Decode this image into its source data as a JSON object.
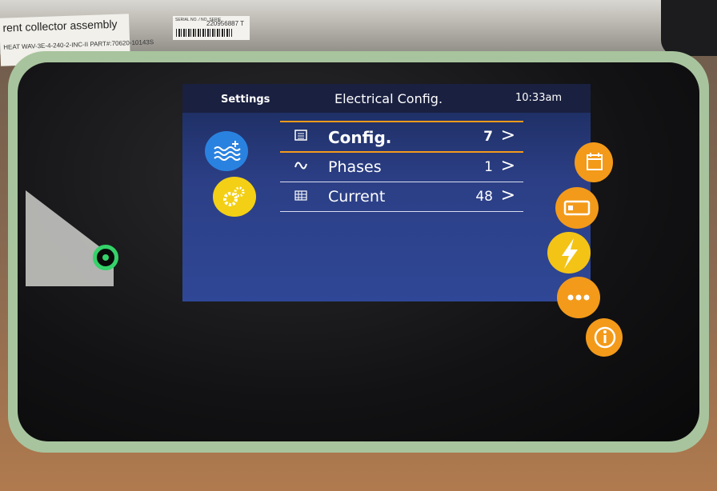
{
  "environment": {
    "sticker_title": "rent collector assembly",
    "sticker_line": "HEAT WAV-3E-4-240-2-INC-II  PART#:70620-10143S",
    "serial_label": "SERIAL NO. / NO. SERIE",
    "serial_number": "220956887 T"
  },
  "header": {
    "settings_label": "Settings",
    "title": "Electrical Config.",
    "time": "10:33am"
  },
  "menu": {
    "items": [
      {
        "label": "Config.",
        "value": "7",
        "chevron": ">"
      },
      {
        "label": "Phases",
        "value": "1",
        "chevron": ">"
      },
      {
        "label": "Current",
        "value": "48",
        "chevron": ">"
      }
    ]
  },
  "colors": {
    "accent_orange": "#f39a1a",
    "accent_yellow": "#f3d015",
    "water_blue": "#2a82e0",
    "power_green": "#35d26a"
  },
  "icons": {
    "left_nav": [
      "water-heater-icon",
      "gear-icon"
    ],
    "right_nav": [
      "calendar-icon",
      "battery-icon",
      "lightning-bolt-icon",
      "more-icon",
      "info-icon"
    ],
    "menu": [
      "config-list-icon",
      "sine-wave-icon",
      "current-meter-icon"
    ]
  }
}
